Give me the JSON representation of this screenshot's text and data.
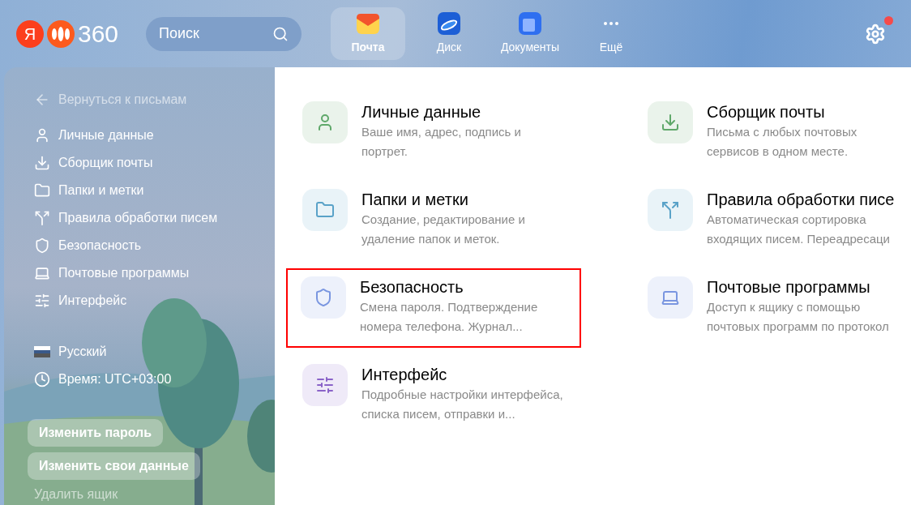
{
  "header": {
    "logo_letter": "Я",
    "logo_text": "360",
    "search": {
      "placeholder": "Поиск"
    },
    "apps": [
      {
        "kind": "mail",
        "label": "Почта",
        "selected": true
      },
      {
        "kind": "disk",
        "label": "Диск",
        "selected": false
      },
      {
        "kind": "docs",
        "label": "Документы",
        "selected": false
      },
      {
        "kind": "more",
        "label": "Ещё",
        "selected": false
      }
    ],
    "settings_notification": true
  },
  "sidebar": {
    "back": "Вернуться к письмам",
    "items": [
      {
        "kind": "user",
        "label": "Личные данные"
      },
      {
        "kind": "collector",
        "label": "Сборщик почты"
      },
      {
        "kind": "folder",
        "label": "Папки и метки"
      },
      {
        "kind": "rules",
        "label": "Правила обработки писем"
      },
      {
        "kind": "shield",
        "label": "Безопасность"
      },
      {
        "kind": "laptop",
        "label": "Почтовые программы"
      },
      {
        "kind": "sliders",
        "label": "Интерфейс"
      }
    ],
    "language": "Русский",
    "time": "Время: UTC+03:00",
    "buttons": [
      "Изменить пароль",
      "Изменить свои данные"
    ],
    "delete_link": "Удалить ящик"
  },
  "cards": [
    {
      "kind": "user",
      "color": "#5fa86a",
      "title": "Личные данные",
      "description": "Ваше имя, адрес, подпись и портрет.",
      "highlighted": false
    },
    {
      "kind": "collector",
      "color": "#5fa86a",
      "title": "Сборщик почты",
      "description": "Письма с любых почтовых сервисов в одном месте.",
      "highlighted": false
    },
    {
      "kind": "folder",
      "color": "#5aa2c8",
      "title": "Папки и метки",
      "description": "Создание, редактирование и удаление папок и меток.",
      "highlighted": false
    },
    {
      "kind": "rules",
      "color": "#5aa2c8",
      "title": "Правила обработки писе",
      "description": "Автоматическая сортировка входящих писем. Переадресаци",
      "highlighted": false
    },
    {
      "kind": "shield",
      "color": "#7a96e0",
      "title": "Безопасность",
      "description": "Смена пароля. Подтверждение номера телефона. Журнал...",
      "highlighted": true
    },
    {
      "kind": "laptop",
      "color": "#7a96e0",
      "title": "Почтовые программы",
      "description": "Доступ к ящику с помощью почтовых программ по протокол",
      "highlighted": false
    },
    {
      "kind": "sliders",
      "color": "#8a63c8",
      "title": "Интерфейс",
      "description": "Подробные настройки интерфейса, списка писем, отправки и...",
      "highlighted": false
    }
  ]
}
